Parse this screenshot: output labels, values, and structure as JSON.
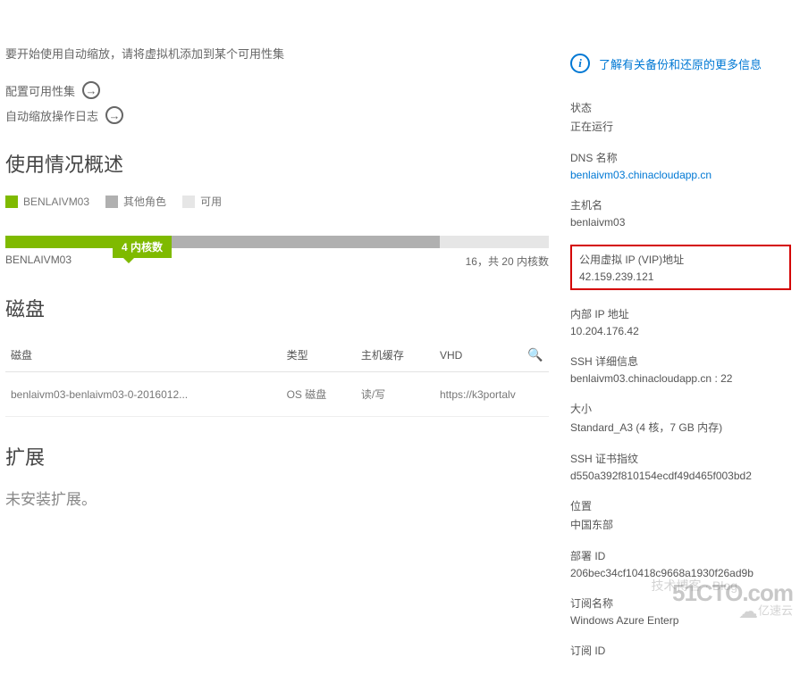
{
  "hint": "要开始使用自动缩放，请将虚拟机添加到某个可用性集",
  "links": {
    "configure_availability": "配置可用性集",
    "autoscale_log": "自动缩放操作日志"
  },
  "sections": {
    "usage_overview": "使用情况概述",
    "disks": "磁盘",
    "extensions": "扩展"
  },
  "legend": {
    "vm": "BENLAIVM03",
    "other_roles": "其他角色",
    "available": "可用"
  },
  "cores_badge": "4 内核数",
  "bar": {
    "left_label": "BENLAIVM03",
    "right_label": "16，共 20 内核数"
  },
  "disk_table": {
    "headers": {
      "name": "磁盘",
      "type": "类型",
      "host_cache": "主机缓存",
      "vhd": "VHD"
    },
    "rows": [
      {
        "name": "benlaivm03-benlaivm03-0-2016012...",
        "type": "OS 磁盘",
        "host_cache": "读/写",
        "vhd": "https://k3portalv"
      }
    ]
  },
  "extensions_empty": "未安装扩展。",
  "info_link": "了解有关备份和还原的更多信息",
  "props": {
    "status": {
      "label": "状态",
      "value": "正在运行"
    },
    "dns": {
      "label": "DNS 名称",
      "value": "benlaivm03.chinacloudapp.cn"
    },
    "hostname": {
      "label": "主机名",
      "value": "benlaivm03"
    },
    "vip": {
      "label": "公用虚拟 IP (VIP)地址",
      "value": "42.159.239.121"
    },
    "internal_ip": {
      "label": "内部 IP 地址",
      "value": "10.204.176.42"
    },
    "ssh": {
      "label": "SSH 详细信息",
      "value": "benlaivm03.chinacloudapp.cn : 22"
    },
    "size": {
      "label": "大小",
      "value": "Standard_A3 (4 核，7 GB 内存)"
    },
    "ssh_fp": {
      "label": "SSH 证书指纹",
      "value": "d550a392f810154ecdf49d465f003bd2"
    },
    "location": {
      "label": "位置",
      "value": "中国东部"
    },
    "deploy_id": {
      "label": "部署 ID",
      "value": "206bec34cf10418c9668a1930f26ad9b"
    },
    "sub_name": {
      "label": "订阅名称",
      "value": "Windows Azure Enterp"
    },
    "sub_id": {
      "label": "订阅 ID",
      "value": ""
    }
  },
  "watermarks": {
    "w1": "51CTO.com",
    "w2": "技术博客 · Blog",
    "w3": "亿速云"
  }
}
